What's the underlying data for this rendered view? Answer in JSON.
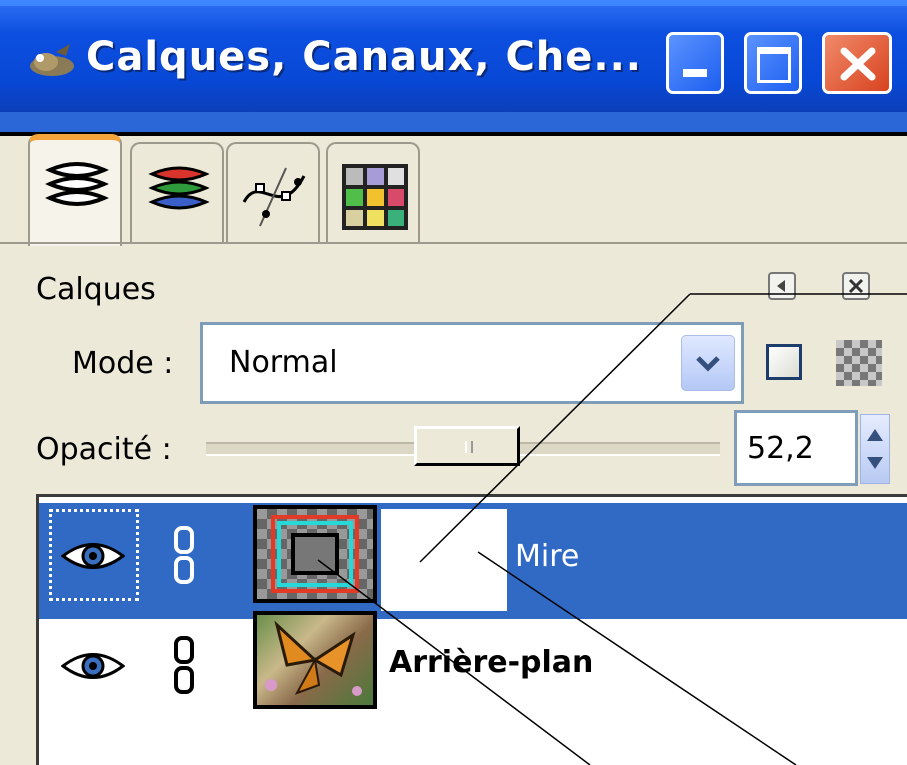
{
  "window": {
    "title": "Calques, Canaux, Che...",
    "buttons": [
      "minimize",
      "maximize",
      "close"
    ]
  },
  "tabs": [
    {
      "name": "layers",
      "icon": "layers-icon",
      "active": true
    },
    {
      "name": "channels",
      "icon": "channels-icon",
      "active": false
    },
    {
      "name": "paths",
      "icon": "paths-icon",
      "active": false
    },
    {
      "name": "colormap",
      "icon": "colormap-icon",
      "active": false
    }
  ],
  "panel": {
    "title": "Calques",
    "mode_label": "Mode :",
    "mode_value": "Normal",
    "opacity_label": "Opacité :",
    "opacity_value": "52,2",
    "opacity_fraction": 0.522
  },
  "layers": [
    {
      "name": "Mire",
      "visible": true,
      "selected": true,
      "bold": false
    },
    {
      "name": "Arrière-plan",
      "visible": true,
      "selected": false,
      "bold": true
    }
  ],
  "colors": {
    "titlebar": "#0848d6",
    "selection": "#316ac5",
    "close_button": "#d8431f",
    "active_tab": "#f3a53b"
  }
}
